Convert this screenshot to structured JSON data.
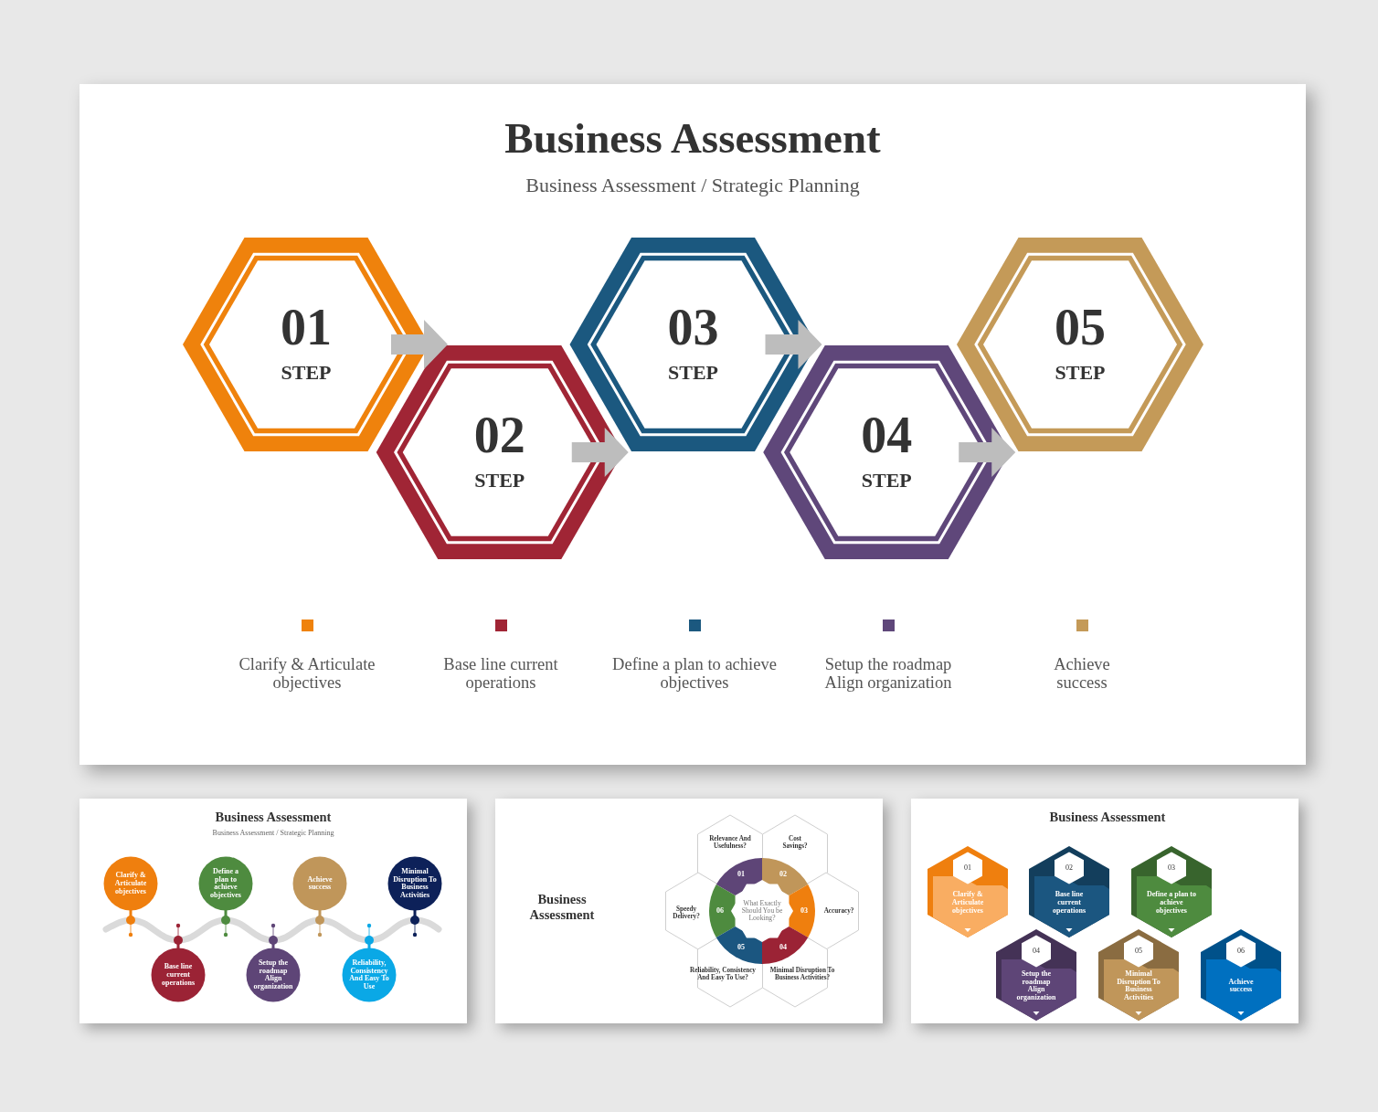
{
  "main_slide": {
    "title": "Business Assessment",
    "subtitle": "Business Assessment / Strategic Planning",
    "steps": [
      {
        "number": "01",
        "label": "STEP",
        "color": "#ef820c",
        "caption": "Clarify & Articulate\nobjectives"
      },
      {
        "number": "02",
        "label": "STEP",
        "color": "#a02535",
        "caption": "Base line current\noperations"
      },
      {
        "number": "03",
        "label": "STEP",
        "color": "#1b587f",
        "caption": "Define a plan to achieve\nobjectives"
      },
      {
        "number": "04",
        "label": "STEP",
        "color": "#5f477a",
        "caption": "Setup the roadmap\nAlign organization"
      },
      {
        "number": "05",
        "label": "STEP",
        "color": "#c49a58",
        "caption": "Achieve\nsuccess"
      }
    ]
  },
  "timeline_slide": {
    "title": "Business Assessment",
    "subtitle": "Business Assessment / Strategic Planning",
    "items": [
      {
        "text": "Clarify &\nArticulate\nobjectives",
        "color": "#ef7f0e"
      },
      {
        "text": "Base line\ncurrent\noperations",
        "color": "#9b2335"
      },
      {
        "text": "Define a\nplan to\nachieve\nobjectives",
        "color": "#4e8b3f"
      },
      {
        "text": "Setup the\nroadmap\nAlign\norganization",
        "color": "#5e4577"
      },
      {
        "text": "Achieve\nsuccess",
        "color": "#c0965a"
      },
      {
        "text": "Reliability,\nConsistency\nAnd Easy To\nUse",
        "color": "#0aa8e6"
      },
      {
        "text": "Minimal\nDisruption To\nBusiness\nActivities",
        "color": "#0d2159"
      }
    ]
  },
  "honeycomb_slide": {
    "title": "Business\nAssessment",
    "center": "What Exactly\nShould You be\nLooking?",
    "segments": [
      {
        "number": "01",
        "color": "#5e4577",
        "question": "Relevance And\nUsefulness?"
      },
      {
        "number": "02",
        "color": "#c0965a",
        "question": "Cost\nSavings?"
      },
      {
        "number": "06",
        "color": "#4e8b3f",
        "question": "Speedy\nDelivery?"
      },
      {
        "number": "03",
        "color": "#ef7f0e",
        "question": "Accuracy?"
      },
      {
        "number": "05",
        "color": "#1b5680",
        "question": "Reliability, Consistency\nAnd Easy To Use?"
      },
      {
        "number": "04",
        "color": "#9b2335",
        "question": "Minimal Disruption To\nBusiness Activities?"
      }
    ]
  },
  "hexagon_slide": {
    "title": "Business Assessment",
    "items": [
      {
        "number": "01",
        "text": "Clarify &\nArticulate\nobjectives",
        "color": "#f9ad62"
      },
      {
        "number": "02",
        "text": "Base line\ncurrent\noperations",
        "color": "#1b5680"
      },
      {
        "number": "03",
        "text": "Define a plan to\nachieve\nobjectives",
        "color": "#4e8b3f"
      },
      {
        "number": "04",
        "text": "Setup the\nroadmap\nAlign\norganization",
        "color": "#5e4577"
      },
      {
        "number": "05",
        "text": "Minimal\nDisruption To\nBusiness\nActivities",
        "color": "#c0965a"
      },
      {
        "number": "06",
        "text": "Achieve\nsuccess",
        "color": "#0070c0"
      }
    ]
  }
}
